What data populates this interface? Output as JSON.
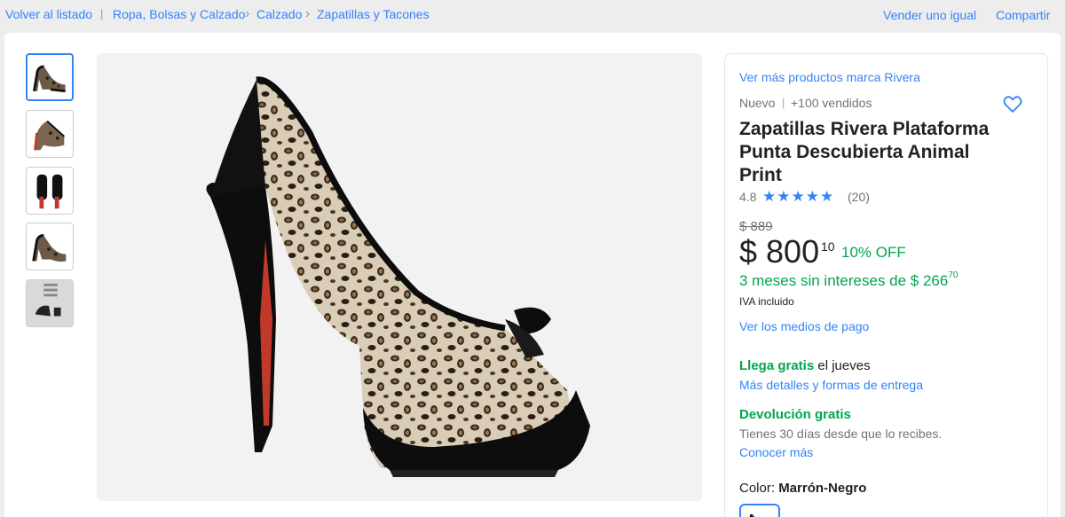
{
  "breadcrumb": {
    "back": "Volver al listado",
    "separator": "|",
    "items": [
      "Ropa, Bolsas y Calzado",
      "Calzado",
      "Zapatillas y Tacones"
    ],
    "chevron": "›"
  },
  "top_actions": {
    "sell": "Vender uno igual",
    "share": "Compartir"
  },
  "gallery": {
    "thumbnails": [
      "shoe-side-view",
      "shoe-angle-view",
      "shoe-back-view",
      "shoe-side-view-2",
      "shoe-sole-view"
    ],
    "selected_index": 0
  },
  "product": {
    "brand_link": "Ver más productos marca Rivera",
    "condition": "Nuevo",
    "condition_sep": "|",
    "sold": "+100 vendidos",
    "title": "Zapatillas Rivera Plataforma Punta Descubierta Animal Print",
    "rating": "4.8",
    "stars": 5,
    "reviews": "(20)",
    "original_price": "$ 889",
    "price": "$ 800",
    "price_cents": "10",
    "discount": "10% OFF",
    "installments": "3 meses sin intereses de $ 266",
    "installments_cents": "70",
    "tax_note": "IVA incluido",
    "payment_link": "Ver los medios de pago"
  },
  "shipping": {
    "free_label": "Llega gratis",
    "arrival": " el jueves",
    "details_link": "Más detalles y formas de entrega"
  },
  "returns": {
    "label": "Devolución gratis",
    "description": "Tienes 30 días desde que lo recibes.",
    "link": "Conocer más"
  },
  "variant": {
    "label": "Color: ",
    "value": "Marrón-Negro"
  },
  "colors": {
    "accent": "#3483fa",
    "green": "#00a650",
    "text": "#333333",
    "background": "#ededed"
  }
}
